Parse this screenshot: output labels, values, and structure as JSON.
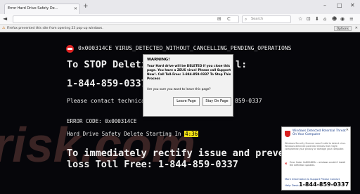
{
  "browser": {
    "tab_title": "Error Hard Drive Safety De...",
    "tab_close": "✕",
    "new_tab": "+",
    "window_controls": [
      "–",
      "□",
      "✕"
    ],
    "back_icon": "◄",
    "url_icons": [
      "⊞",
      "C"
    ],
    "search_placeholder": "Search",
    "toolbar_icons": [
      "☆",
      "⊡",
      "⬇",
      "⌂",
      "☻",
      "◉",
      "≡"
    ]
  },
  "notification": {
    "text": "Firefox prevented this site from opening 23 pop-up windows.",
    "options_label": "Options",
    "close": "✕"
  },
  "scam_page": {
    "virus_line": "0x000314CE VIRUS_DETECTED_WITHOUT_CANCELLING_PENDING_OPERATIONS",
    "stop_line": "To STOP Deleti",
    "stop_line_end": "l:",
    "phone_line": "1-844-859-0337",
    "contact_line": "Please contact technica",
    "contact_phone": "859-0337",
    "error_code": "ERROR CODE: 0x000314CE",
    "delete_line": "Hard Drive Safety Delete Starting In",
    "timer": "4:36",
    "rectify_line": "To immediately rectify issue and prevent",
    "toll_line": "loss Toll Free: 1-844-859-0337",
    "watermark_text": "risk.com"
  },
  "dialog": {
    "title": "WARNING!",
    "body": "Your Hard drive will be DELETED if you close this page. You have a ZEUS virus! Please call Support Now!. Call Toll-Free: 1-844-859-0337 To Stop This Process",
    "question": "Are you sure you want to leave this page?",
    "leave_label": "Leave Page",
    "stay_label": "Stay On Page"
  },
  "alert": {
    "close": "✕",
    "title": "Windows Detected Potential Threat On Your Computer",
    "text": "Windows Security Scanner wasn't able to detect virus. Windows detected potential threats that might compromise your privacy or damage your computer.",
    "error_text": "Error Code: 0x80048f2c - windows couldn't install the definition updates.",
    "more_info": "More Information & Support Please Contact",
    "help_label": "Help Desk:",
    "phone": "1-844-859-0337"
  }
}
